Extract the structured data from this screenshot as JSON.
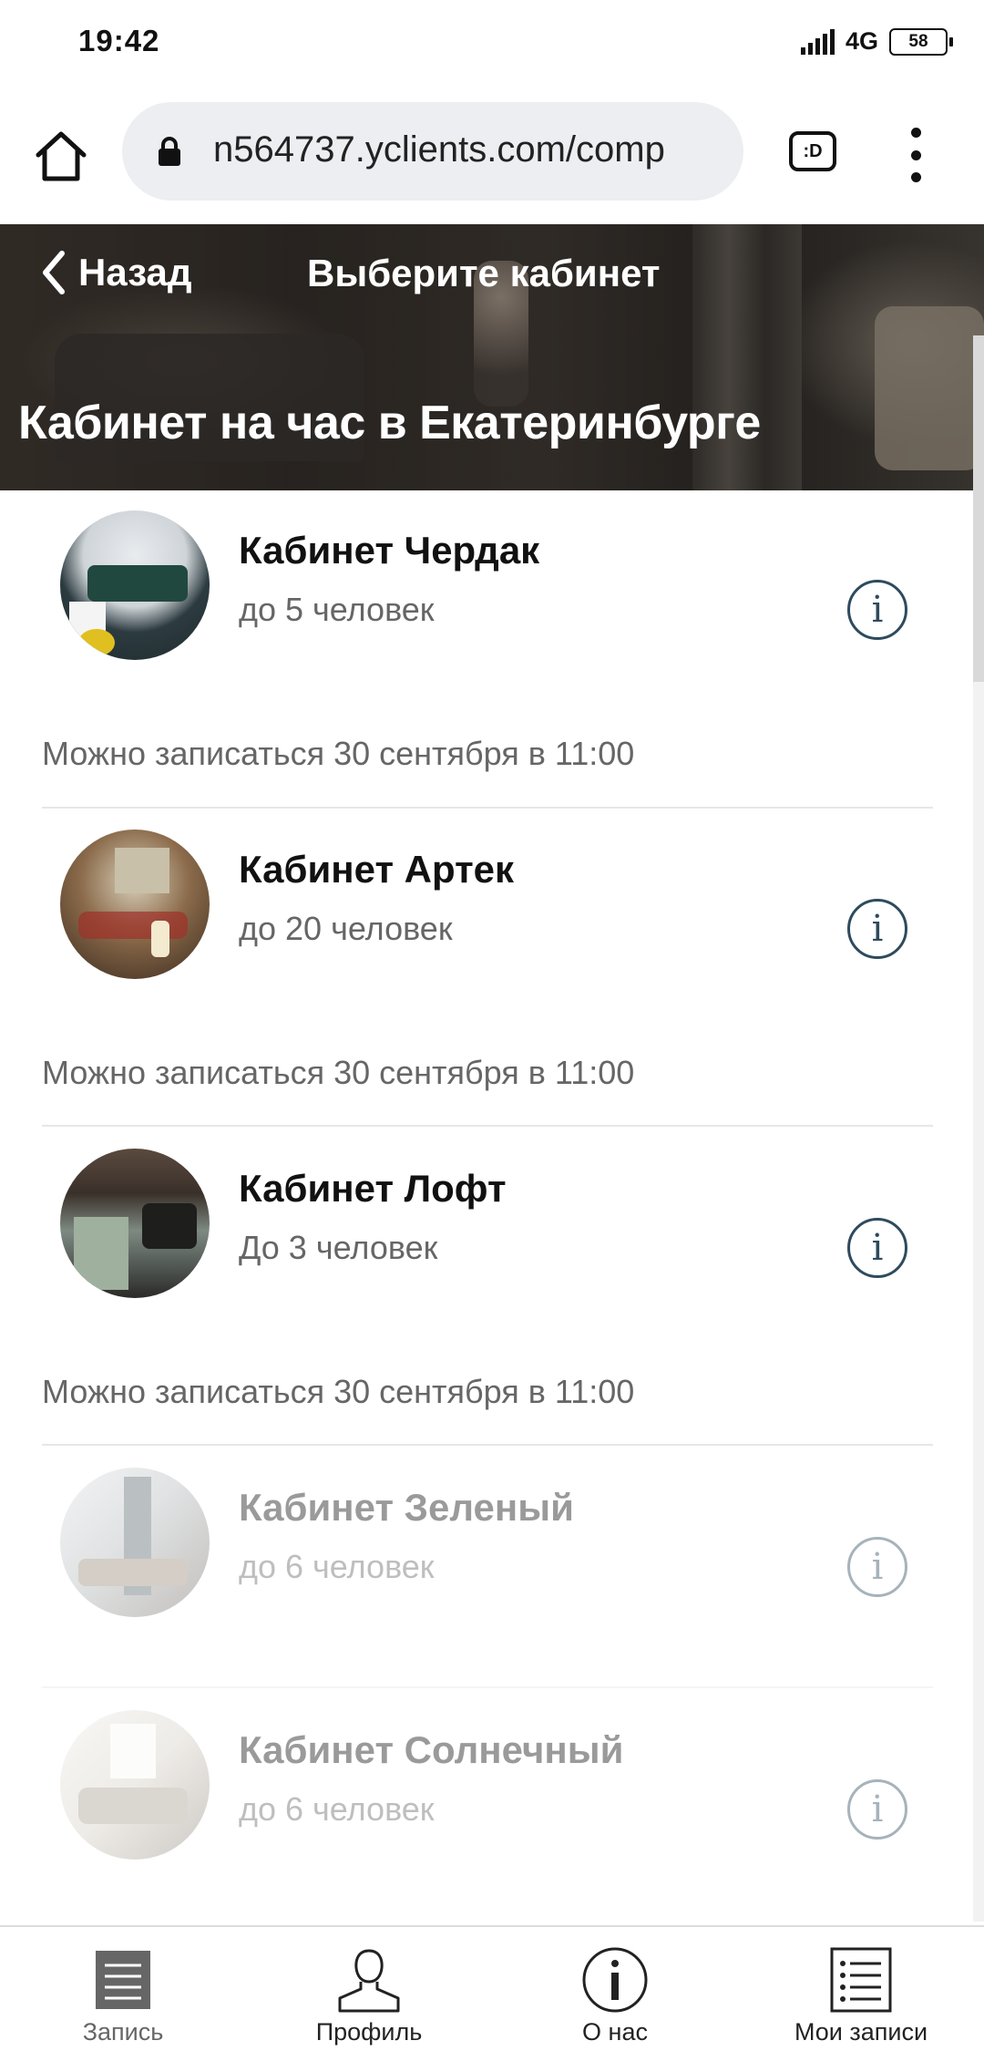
{
  "status_bar": {
    "time": "19:42",
    "network": "4G",
    "battery": "58"
  },
  "browser": {
    "url": "n564737.yclients.com/comp",
    "tab_label": ":D"
  },
  "header": {
    "back_label": "Назад",
    "title": "Выберите кабинет",
    "heading": "Кабинет на час в Екатеринбурге"
  },
  "rooms": [
    {
      "name": "Кабинет Чердак",
      "capacity": "до 5 человек",
      "availability": "Можно записаться 30 сентября в 11:00",
      "info_icon": "info-icon"
    },
    {
      "name": "Кабинет Артек",
      "capacity": "до 20 человек",
      "availability": "Можно записаться 30 сентября в 11:00",
      "info_icon": "info-icon"
    },
    {
      "name": "Кабинет Лофт",
      "capacity": "До 3 человек",
      "availability": "Можно записаться 30 сентября в 11:00",
      "info_icon": "info-icon"
    },
    {
      "name": "Кабинет Зеленый",
      "capacity": "до 6 человек",
      "info_icon": "info-icon"
    },
    {
      "name": "Кабинет Солнечный",
      "capacity": "до 6 человек",
      "info_icon": "info-icon"
    }
  ],
  "bottom_nav": [
    {
      "label": "Запись",
      "icon": "booking-icon"
    },
    {
      "label": "Профиль",
      "icon": "profile-icon"
    },
    {
      "label": "О нас",
      "icon": "info-icon"
    },
    {
      "label": "Мои записи",
      "icon": "list-icon"
    }
  ],
  "colors": {
    "accent": "#2e4b5e",
    "text_secondary": "#666666",
    "divider": "#e7e7e7"
  }
}
